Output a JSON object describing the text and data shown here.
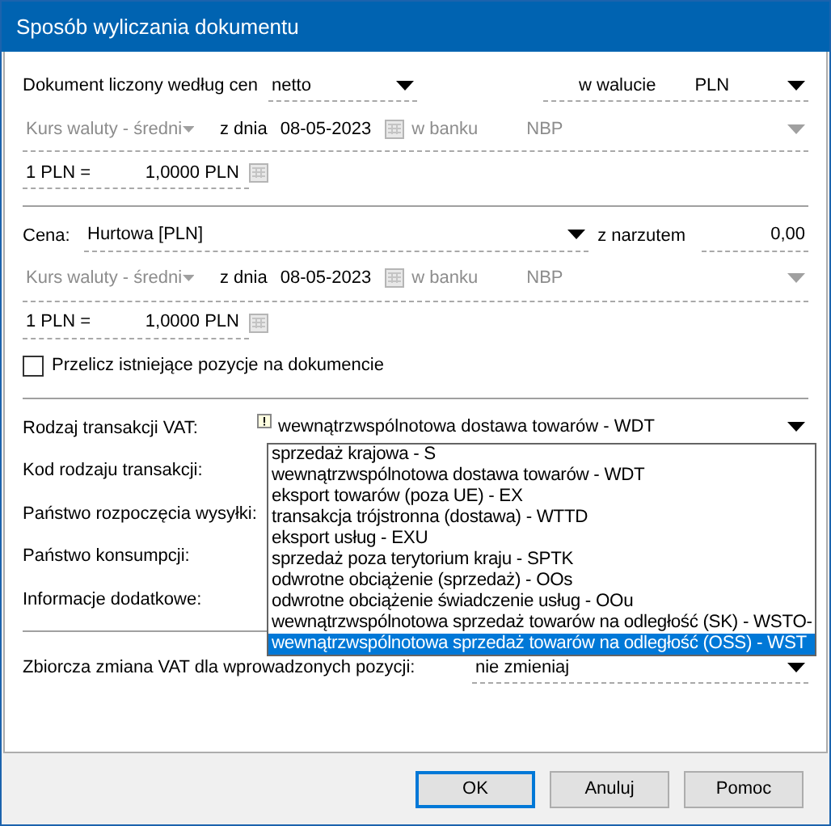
{
  "window": {
    "title": "Sposób wyliczania dokumentu"
  },
  "document_price": {
    "label": "Dokument liczony według cen",
    "value": "netto",
    "currency_label": "w walucie",
    "currency": "PLN"
  },
  "document_rate": {
    "rate_type": "Kurs waluty - średni",
    "date_label": "z dnia",
    "date": "08-05-2023",
    "bank_label": "w banku",
    "bank": "NBP",
    "disabled": true,
    "conversion_left": "1 PLN =",
    "conversion_right": "1,0000 PLN"
  },
  "price": {
    "label": "Cena:",
    "value": "Hurtowa [PLN]",
    "markup_label": "z narzutem",
    "markup": "0,00"
  },
  "price_rate": {
    "rate_type": "Kurs waluty - średni",
    "date_label": "z dnia",
    "date": "08-05-2023",
    "bank_label": "w banku",
    "bank": "NBP",
    "disabled": true,
    "conversion_left": "1 PLN =",
    "conversion_right": "1,0000 PLN"
  },
  "recalculate": {
    "label": "Przelicz istniejące pozycje na dokumencie",
    "checked": false
  },
  "vat_fields": [
    {
      "label": "Rodzaj transakcji VAT:",
      "value": "wewnątrzwspólnotowa dostawa towarów - WDT",
      "expanded": true
    },
    {
      "label": "Kod rodzaju transakcji:"
    },
    {
      "label": "Państwo rozpoczęcia wysyłki:"
    },
    {
      "label": "Państwo konsumpcji:"
    },
    {
      "label": "Informacje dodatkowe:"
    }
  ],
  "vat_options": [
    {
      "label": "sprzedaż krajowa - S",
      "selected": false
    },
    {
      "label": "wewnątrzwspólnotowa dostawa towarów - WDT",
      "selected": false
    },
    {
      "label": "eksport towarów (poza UE) - EX",
      "selected": false
    },
    {
      "label": "transakcja trójstronna (dostawa) - WTTD",
      "selected": false
    },
    {
      "label": "eksport usług - EXU",
      "selected": false
    },
    {
      "label": "sprzedaż poza terytorium kraju - SPTK",
      "selected": false
    },
    {
      "label": "odwrotne obciążenie (sprzedaż) - OOs",
      "selected": false
    },
    {
      "label": "odwrotne obciążenie świadczenie usług - OOu",
      "selected": false
    },
    {
      "label": "wewnątrzwspólnotowa sprzedaż towarów na odległość (SK) - WSTO-",
      "selected": false
    },
    {
      "label": "wewnątrzwspólnotowa sprzedaż towarów na odległość (OSS) - WST",
      "selected": true
    }
  ],
  "vat_change": {
    "label": "Zbiorcza zmiana VAT dla wprowadzonych pozycji:",
    "value": "nie zmieniaj"
  },
  "buttons": [
    {
      "label": "OK",
      "default": true
    },
    {
      "label": "Anuluj",
      "default": false
    },
    {
      "label": "Pomoc",
      "default": false
    }
  ]
}
